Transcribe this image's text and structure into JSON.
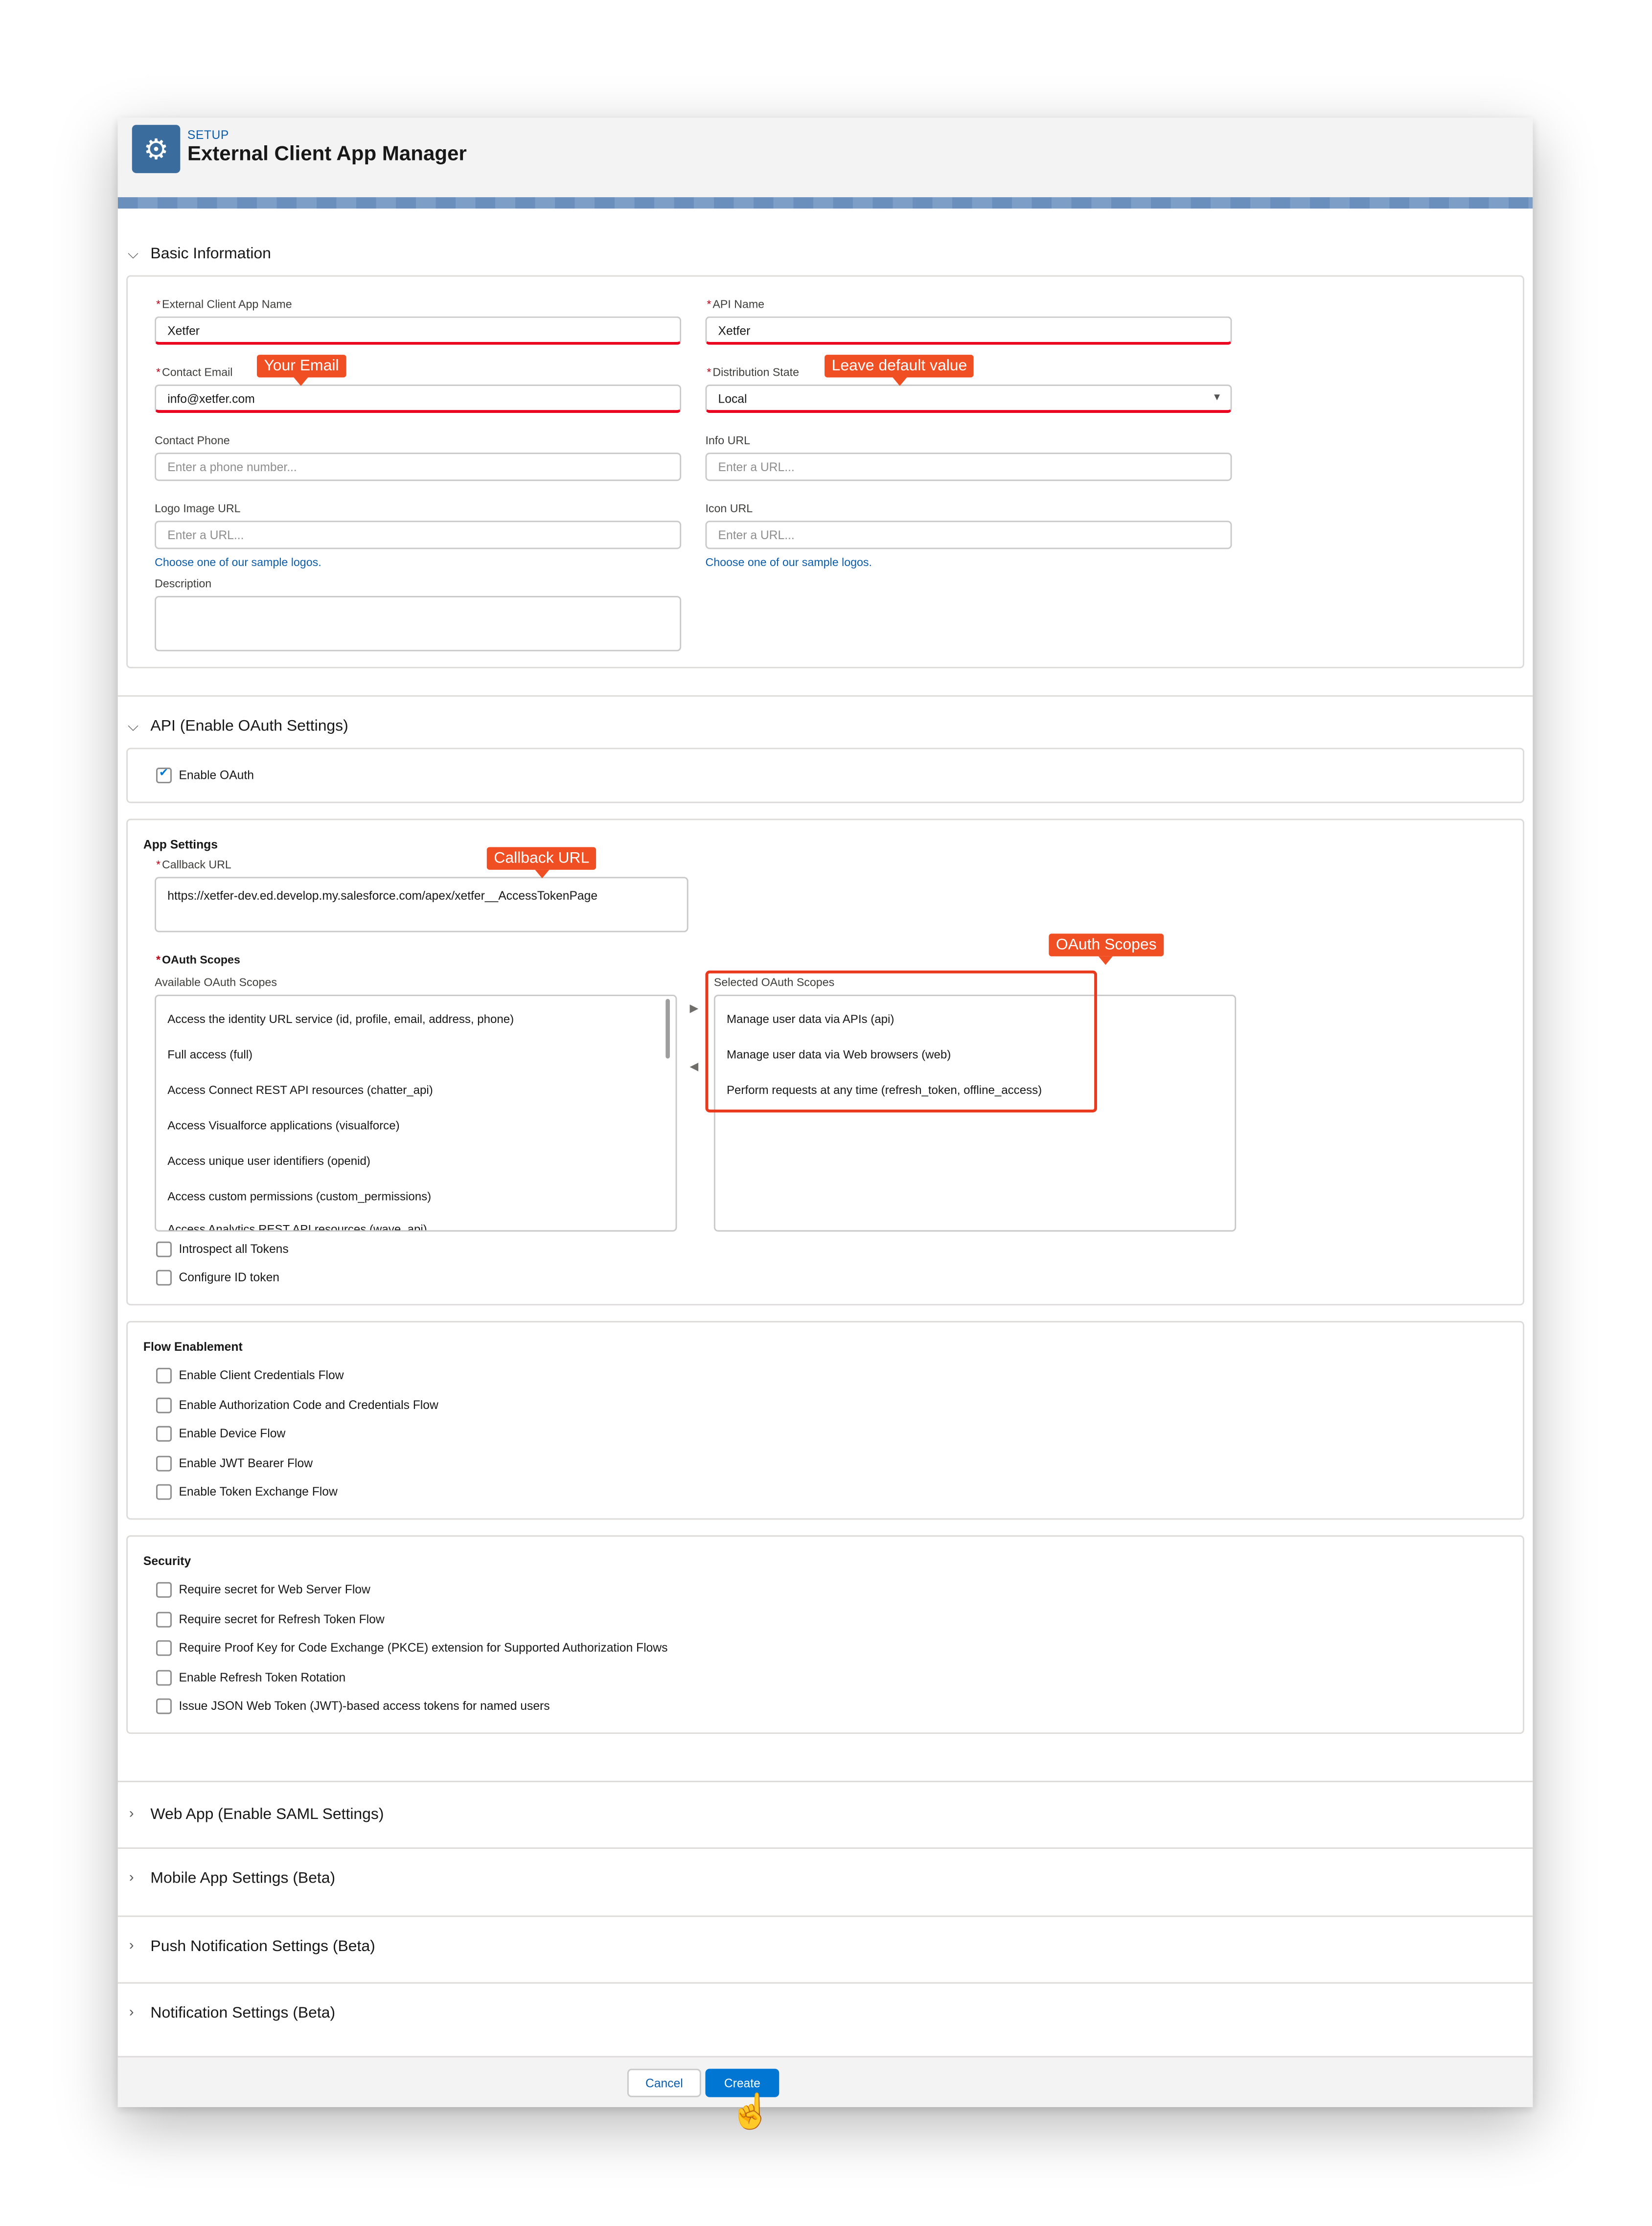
{
  "header": {
    "setup": "SETUP",
    "title": "External Client App Manager"
  },
  "basic": {
    "title": "Basic Information",
    "app_name_label": "External Client App Name",
    "app_name_value": "Xetfer",
    "api_name_label": "API Name",
    "api_name_value": "Xetfer",
    "email_label": "Contact Email",
    "email_value": "info@xetfer.com",
    "dist_label": "Distribution State",
    "dist_value": "Local",
    "phone_label": "Contact Phone",
    "phone_placeholder": "Enter a phone number...",
    "info_label": "Info URL",
    "info_placeholder": "Enter a URL...",
    "logo_label": "Logo Image URL",
    "logo_placeholder": "Enter a URL...",
    "icon_label": "Icon URL",
    "icon_placeholder": "Enter a URL...",
    "sample_logos_link": "Choose one of our sample logos.",
    "description_label": "Description"
  },
  "api": {
    "title": "API (Enable OAuth Settings)",
    "enable_oauth": "Enable OAuth"
  },
  "app_settings": {
    "title": "App Settings",
    "callback_label": "Callback URL",
    "callback_value": "https://xetfer-dev.ed.develop.my.salesforce.com/apex/xetfer__AccessTokenPage",
    "scopes_label": "OAuth Scopes",
    "available_label": "Available OAuth Scopes",
    "selected_label": "Selected OAuth Scopes",
    "available": [
      "Access the identity URL service (id, profile, email, address, phone)",
      "Full access (full)",
      "Access Connect REST API resources (chatter_api)",
      "Access Visualforce applications (visualforce)",
      "Access unique user identifiers (openid)",
      "Access custom permissions (custom_permissions)",
      "Access Analytics REST API resources (wave_api)"
    ],
    "selected": [
      "Manage user data via APIs (api)",
      "Manage user data via Web browsers (web)",
      "Perform requests at any time (refresh_token, offline_access)"
    ],
    "introspect": "Introspect all Tokens",
    "configure_id": "Configure ID token"
  },
  "flow": {
    "title": "Flow Enablement",
    "items": [
      "Enable Client Credentials Flow",
      "Enable Authorization Code and Credentials Flow",
      "Enable Device Flow",
      "Enable JWT Bearer Flow",
      "Enable Token Exchange Flow"
    ]
  },
  "security": {
    "title": "Security",
    "items": [
      "Require secret for Web Server Flow",
      "Require secret for Refresh Token Flow",
      "Require Proof Key for Code Exchange (PKCE) extension for Supported Authorization Flows",
      "Enable Refresh Token Rotation",
      "Issue JSON Web Token (JWT)-based access tokens for named users"
    ]
  },
  "collapsed": [
    "Web App (Enable SAML Settings)",
    "Mobile App Settings (Beta)",
    "Push Notification Settings (Beta)",
    "Notification Settings (Beta)"
  ],
  "footer": {
    "cancel": "Cancel",
    "create": "Create"
  },
  "callouts": {
    "email": "Your Email",
    "default": "Leave default value",
    "callback": "Callback URL",
    "scopes": "OAuth Scopes"
  },
  "colors": {
    "accent": "#0176d3",
    "callout": "#f04e23",
    "header_icon": "#3b6c9e"
  }
}
